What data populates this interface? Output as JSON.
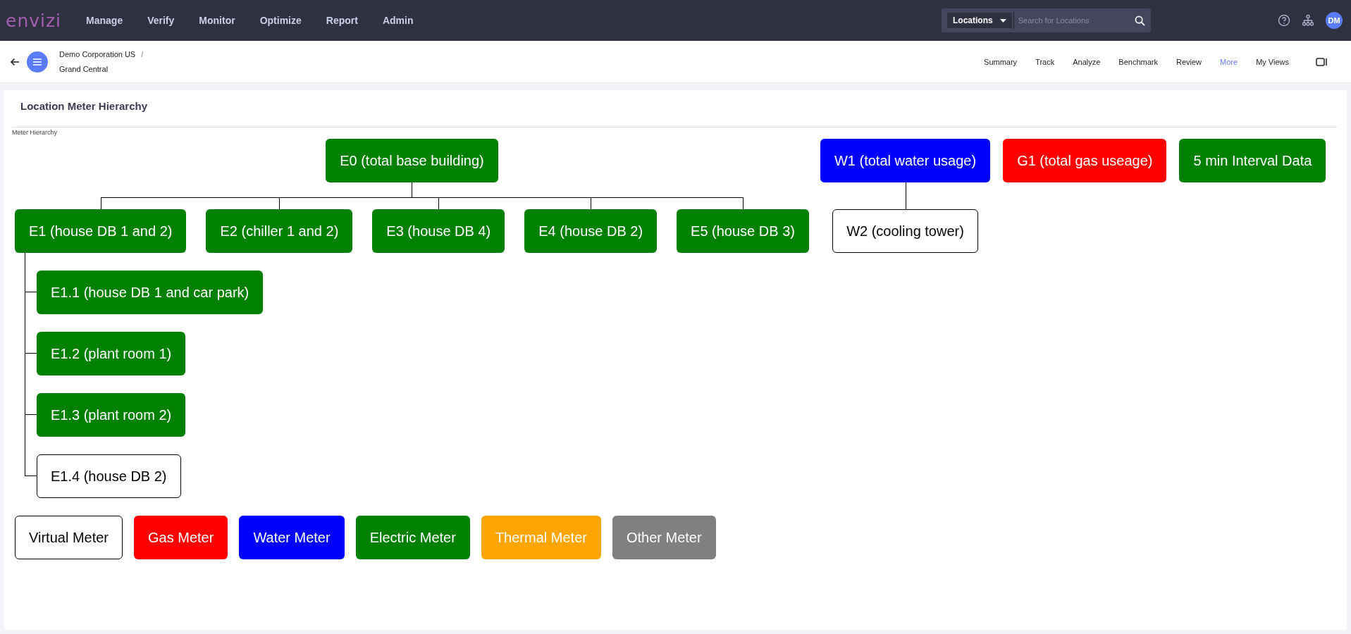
{
  "topbar": {
    "logo": "envizi",
    "menu": [
      "Manage",
      "Verify",
      "Monitor",
      "Optimize",
      "Report",
      "Admin"
    ],
    "search": {
      "scope": "Locations",
      "placeholder": "Search for Locations"
    },
    "user_initials": "DM"
  },
  "breadcrumb": {
    "parent": "Demo Corporation US",
    "separator": "/",
    "current": "Grand Central"
  },
  "tabs": [
    {
      "label": "Summary",
      "selected": false
    },
    {
      "label": "Track",
      "selected": false
    },
    {
      "label": "Analyze",
      "selected": false
    },
    {
      "label": "Benchmark",
      "selected": false
    },
    {
      "label": "Review",
      "selected": false
    },
    {
      "label": "More",
      "selected": true
    },
    {
      "label": "My Views",
      "selected": false
    }
  ],
  "panel": {
    "title": "Location Meter Hierarchy",
    "section_label": "Meter Hierarchy",
    "meters": [
      {
        "label": "E0 (total base building)",
        "kind": "electric",
        "children": [
          {
            "label": "E1 (house DB 1 and 2)",
            "kind": "electric",
            "children": [
              {
                "label": "E1.1 (house DB 1 and car park)",
                "kind": "electric"
              },
              {
                "label": "E1.2 (plant room 1)",
                "kind": "electric"
              },
              {
                "label": "E1.3 (plant room 2)",
                "kind": "electric"
              },
              {
                "label": "E1.4 (house DB 2)",
                "kind": "virtual"
              }
            ]
          },
          {
            "label": "E2 (chiller 1 and 2)",
            "kind": "electric"
          },
          {
            "label": "E3 (house DB 4)",
            "kind": "electric"
          },
          {
            "label": "E4 (house DB 2)",
            "kind": "electric"
          },
          {
            "label": "E5 (house DB 3)",
            "kind": "electric"
          }
        ]
      },
      {
        "label": "W1 (total water usage)",
        "kind": "water",
        "children": [
          {
            "label": "W2 (cooling tower)",
            "kind": "virtual"
          }
        ]
      },
      {
        "label": "G1 (total gas useage)",
        "kind": "gas"
      },
      {
        "label": "5 min Interval Data",
        "kind": "electric"
      }
    ],
    "legend": [
      {
        "label": "Virtual Meter",
        "kind": "virtual"
      },
      {
        "label": "Gas Meter",
        "kind": "gas"
      },
      {
        "label": "Water Meter",
        "kind": "water"
      },
      {
        "label": "Electric Meter",
        "kind": "electric"
      },
      {
        "label": "Thermal Meter",
        "kind": "thermal"
      },
      {
        "label": "Other Meter",
        "kind": "other"
      }
    ]
  }
}
